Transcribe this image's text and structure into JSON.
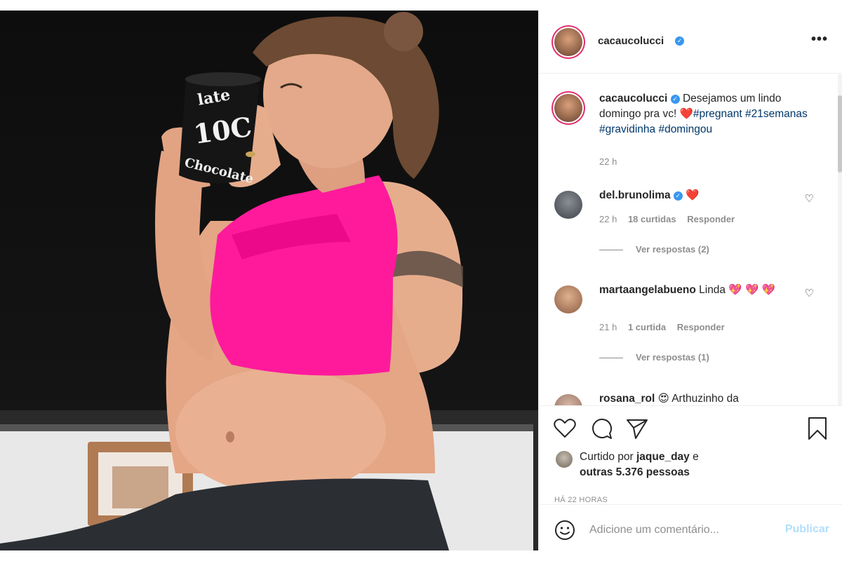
{
  "post": {
    "author": "cacaucolucci",
    "verified": true,
    "more_label": "•••"
  },
  "caption": {
    "author": "cacaucolucci",
    "text": "Desejamos um lindo domingo pra vc! ",
    "heart": "❤️",
    "tags": "#pregnant #21semanas #gravidinha #domingou",
    "time": "22 h"
  },
  "comments": [
    {
      "user": "del.brunolima",
      "verified": true,
      "text": "❤️",
      "time": "22 h",
      "likes": "18 curtidas",
      "reply": "Responder",
      "view_replies": "Ver respostas (2)"
    },
    {
      "user": "martaangelabueno",
      "text": "Linda 💖 💖 💖",
      "time": "21 h",
      "likes": "1 curtida",
      "reply": "Responder",
      "view_replies": "Ver respostas (1)"
    },
    {
      "user": "rosana_rol",
      "text": "😍 Arthuzinho da"
    }
  ],
  "likes": {
    "prefix": "Curtido por ",
    "user": "jaque_day",
    "suffix": " e",
    "others": "outras 5.376 pessoas"
  },
  "posted_ago": "HÁ 22 HORAS",
  "add_comment": {
    "placeholder": "Adicione um comentário...",
    "publish": "Publicar"
  },
  "photo": {
    "mug_text_1": "late",
    "mug_text_2": "10C",
    "mug_text_3": "Chocolate"
  },
  "icons": {
    "like": "heart-outline-icon",
    "comment": "comment-bubble-icon",
    "share": "paper-plane-icon",
    "save": "bookmark-icon",
    "emoji": "smiley-icon"
  },
  "colors": {
    "link": "#00376b",
    "verified": "#3897f0",
    "publish_disabled": "#b2dffc",
    "heart": "#ed4956"
  }
}
